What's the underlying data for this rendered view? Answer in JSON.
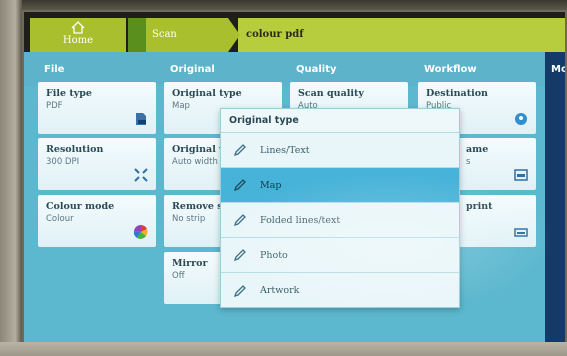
{
  "header": {
    "home_label": "Home",
    "home_icon": "home-icon",
    "breadcrumb": [
      "Scan",
      "colour pdf"
    ],
    "accent": "#a9bf2e"
  },
  "columns": [
    {
      "key": "file",
      "label": "File"
    },
    {
      "key": "original",
      "label": "Original"
    },
    {
      "key": "quality",
      "label": "Quality"
    },
    {
      "key": "workflow",
      "label": "Workflow"
    },
    {
      "key": "more",
      "label": "Mo"
    }
  ],
  "tiles": {
    "file_type": {
      "label": "File type",
      "value": "PDF",
      "icon": "pdf-file-icon"
    },
    "resolution": {
      "label": "Resolution",
      "value": "300 DPI",
      "icon": "resolution-icon"
    },
    "colour_mode": {
      "label": "Colour mode",
      "value": "Colour",
      "icon": "colour-wheel-icon"
    },
    "original_type": {
      "label": "Original type",
      "value": "Map",
      "icon": "dropdown-icon"
    },
    "original_width": {
      "label": "Original w",
      "value": "Auto width"
    },
    "remove_strip": {
      "label": "Remove s",
      "value": "No strip"
    },
    "mirror": {
      "label": "Mirror",
      "value": "Off"
    },
    "scan_quality": {
      "label": "Scan quality",
      "value": "Auto",
      "icon": "status-dot-icon"
    },
    "destination": {
      "label": "Destination",
      "value": "Public",
      "icon": "location-icon"
    },
    "file_name": {
      "label": "ame",
      "value": "s",
      "icon": "file-name-icon"
    },
    "print": {
      "label": "print",
      "value": "",
      "icon": "print-icon"
    }
  },
  "popup": {
    "title": "Original type",
    "options": [
      {
        "label": "Lines/Text",
        "selected": false
      },
      {
        "label": "Map",
        "selected": true
      },
      {
        "label": "Folded lines/text",
        "selected": false
      },
      {
        "label": "Photo",
        "selected": false
      },
      {
        "label": "Artwork",
        "selected": false
      }
    ],
    "selected_color": "#47b3d8"
  }
}
